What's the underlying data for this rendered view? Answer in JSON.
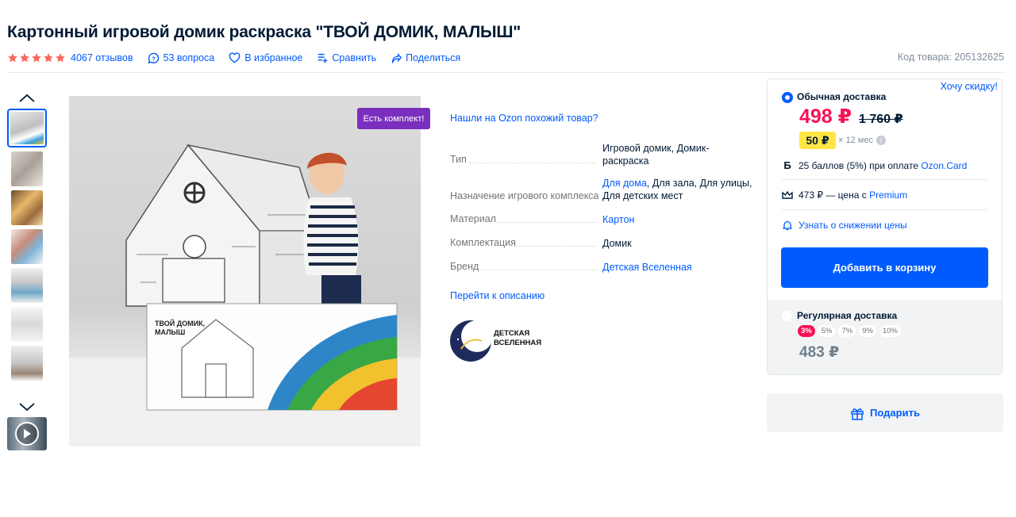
{
  "product": {
    "title": "Картонный игровой домик раскраска \"ТВОЙ ДОМИК, МАЛЫШ\"",
    "rating_stars": 5,
    "reviews": "4067 отзывов",
    "questions": "53 вопроса",
    "favorite": "В избранное",
    "compare": "Сравнить",
    "share": "Поделиться",
    "sku": "Код товара: 205132625"
  },
  "gallery": {
    "badge": "Есть комплект!",
    "thumb_count": 7,
    "active_thumb": 1
  },
  "specs": {
    "similar_link": "Нашли на Ozon похожий товар?",
    "rows": [
      {
        "key": "Тип",
        "value": "Игровой домик, Домик-раскраска"
      },
      {
        "key": "Назначение игрового комплекса",
        "value_link": "Для дома",
        "value_rest": ", Для зала, Для улицы, Для детских мест"
      },
      {
        "key": "Материал",
        "value_link": "Картон"
      },
      {
        "key": "Комплектация",
        "value": "Домик"
      },
      {
        "key": "Бренд",
        "value_link": "Детская Вселенная"
      }
    ],
    "to_description": "Перейти к описанию",
    "brand_logo_line1": "ДЕТСКАЯ",
    "brand_logo_line2": "ВСЕЛЕННАЯ"
  },
  "buybox": {
    "delivery_option": "Обычная доставка",
    "want_discount": "Хочу скидку!",
    "price": "498 ₽",
    "old_price": "1 760 ₽",
    "installment": "50 ₽",
    "installment_term": "× 12 мес",
    "points_text": "25 баллов (5%) при оплате ",
    "points_link": "Ozon.Card",
    "premium_text": "473 ₽ — цена с ",
    "premium_link": "Premium",
    "notify": "Узнать о снижении цены",
    "add_to_cart": "Добавить в корзину",
    "regular_delivery": "Регулярная доставка",
    "percents": [
      "3%",
      "5%",
      "7%",
      "9%",
      "10%"
    ],
    "regular_price": "483 ₽",
    "gift": "Подарить"
  },
  "colors": {
    "accent": "#005bff",
    "price": "#f91155",
    "star": "#f7675c",
    "badge": "#7b2fbe",
    "installment_bg": "#ffe645"
  }
}
